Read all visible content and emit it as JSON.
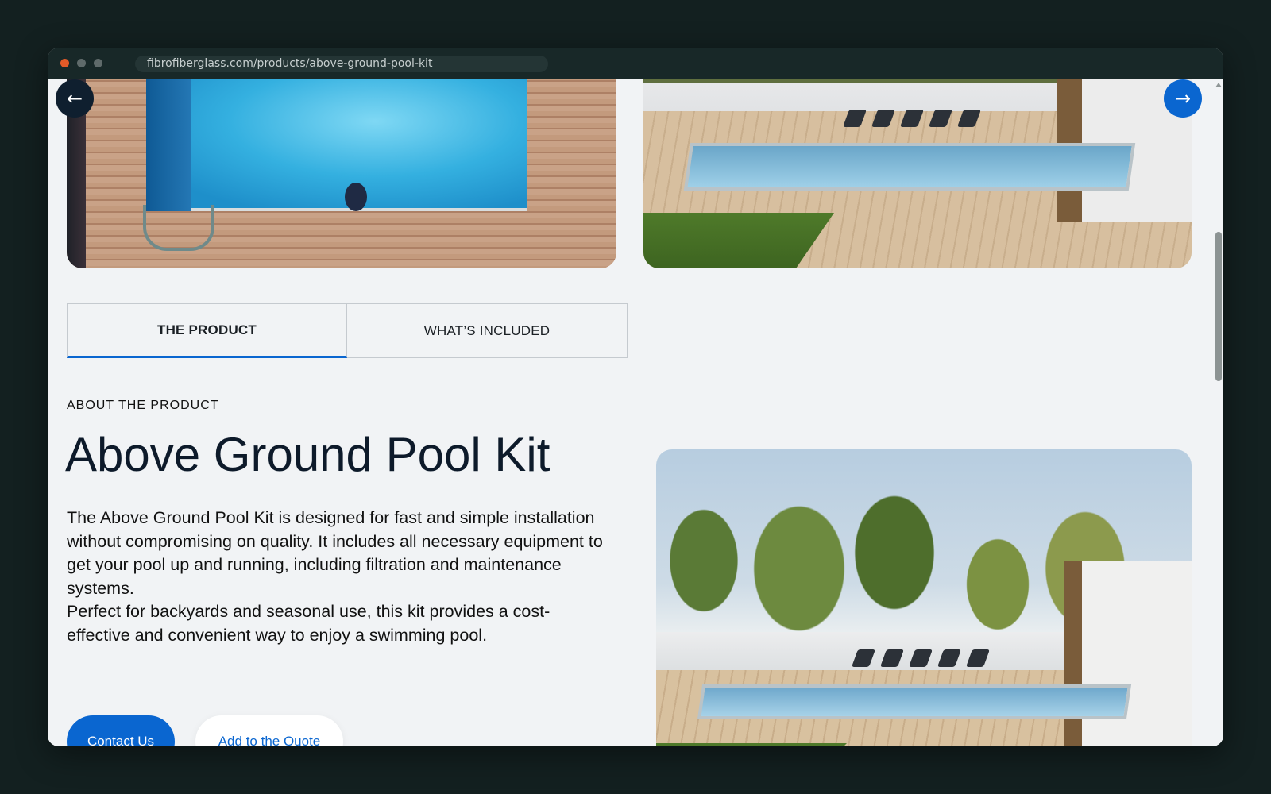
{
  "browser": {
    "url": "fibrofiberglass.com/products/above-ground-pool-kit",
    "controls": {
      "close_color": "#e25a28",
      "minimize_color": "#5f6a6a",
      "zoom_color": "#5f6a6a"
    }
  },
  "carousel": {
    "prev_icon": "arrow-left-icon",
    "next_icon": "arrow-right-icon",
    "prev_glyph": "←",
    "next_glyph": "→"
  },
  "tabs": [
    {
      "label": "THE PRODUCT",
      "active": true
    },
    {
      "label": "WHAT’S INCLUDED",
      "active": false
    }
  ],
  "product": {
    "eyebrow": "ABOUT THE PRODUCT",
    "title": "Above Ground Pool Kit",
    "paragraph_1": "The Above Ground Pool Kit is designed for fast and simple installation without compromising on quality. It includes all necessary equipment to get your pool up and running, including filtration and maintenance systems.",
    "paragraph_2": "Perfect for backyards and seasonal use, this kit provides a cost-effective and convenient way to enjoy a swimming pool."
  },
  "actions": {
    "contact_label": "Contact Us",
    "quote_label": "Add to the Quote"
  },
  "colors": {
    "accent": "#0a66d0",
    "dark_navy": "#0d1a2a",
    "page_bg": "#f1f3f5",
    "backdrop": "#132020"
  }
}
